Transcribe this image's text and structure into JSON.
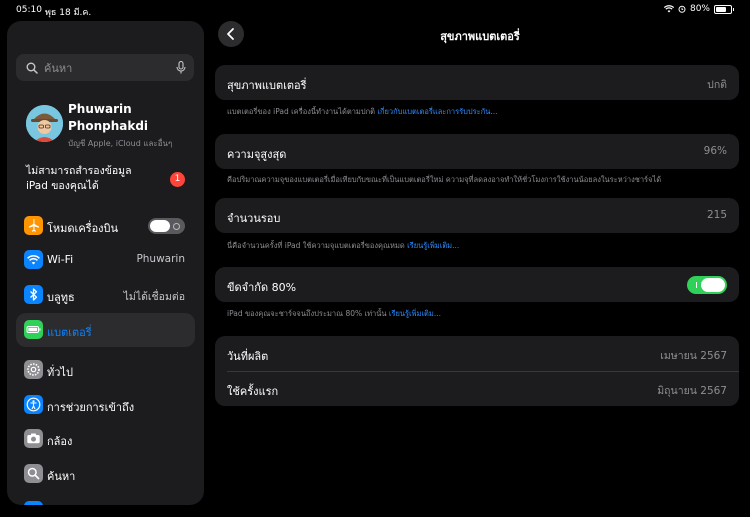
{
  "status": {
    "time": "05:10",
    "date": "พุธ 18 มี.ค.",
    "battery": "80%"
  },
  "sidebar": {
    "search_placeholder": "ค้นหา",
    "profile": {
      "name": "Phuwarin Phonphakdi",
      "subtitle": "บัญชี Apple, iCloud และอื่นๆ"
    },
    "notice": {
      "text": "ไม่สามารถสำรองข้อมูล iPad ของคุณได้",
      "badge": "1"
    },
    "items": [
      {
        "label": "โหมดเครื่องบิน",
        "value": "",
        "icon": "airplane-icon",
        "color": "#ff9500"
      },
      {
        "label": "Wi-Fi",
        "value": "Phuwarin",
        "icon": "wifi-icon",
        "color": "#0a84ff"
      },
      {
        "label": "บลูทูธ",
        "value": "ไม่ได้เชื่อมต่อ",
        "icon": "bluetooth-icon",
        "color": "#0a84ff"
      },
      {
        "label": "แบตเตอรี่",
        "value": "",
        "icon": "battery-icon",
        "color": "#30d158"
      },
      {
        "label": "ทั่วไป",
        "value": "",
        "icon": "gear-icon",
        "color": "#8e8e93"
      },
      {
        "label": "การช่วยการเข้าถึง",
        "value": "",
        "icon": "accessibility-icon",
        "color": "#0a84ff"
      },
      {
        "label": "กล้อง",
        "value": "",
        "icon": "camera-icon",
        "color": "#8e8e93"
      },
      {
        "label": "ค้นหา",
        "value": "",
        "icon": "search-icon",
        "color": "#8e8e93"
      }
    ]
  },
  "main": {
    "title": "สุขภาพแบตเตอรี่",
    "health": {
      "label": "สุขภาพแบตเตอรี่",
      "value": "ปกติ",
      "footer": "แบตเตอรี่ของ iPad เครื่องนี้ทำงานได้ตามปกติ",
      "link": "เกี่ยวกับแบตเตอรี่และการรับประกัน..."
    },
    "max_capacity": {
      "label": "ความจุสูงสุด",
      "value": "96%",
      "footer": "คือปริมาณความจุของแบตเตอรี่เมื่อเทียบกับขณะที่เป็นแบตเตอรี่ใหม่ ความจุที่ลดลงอาจทำให้ชั่วโมงการใช้งานน้อยลงในระหว่างชาร์จได้"
    },
    "cycle_count": {
      "label": "จำนวนรอบ",
      "value": "215",
      "footer": "นี่คือจำนวนครั้งที่ iPad ใช้ความจุแบตเตอรี่ของคุณหมด",
      "link": "เรียนรู้เพิ่มเติม..."
    },
    "limit": {
      "label": "ขีดจำกัด 80%",
      "enabled": true,
      "footer": "iPad ของคุณจะชาร์จจนถึงประมาณ 80% เท่านั้น",
      "link": "เรียนรู้เพิ่มเติม..."
    },
    "dates": {
      "manufacture_label": "วันที่ผลิต",
      "manufacture_value": "เมษายน 2567",
      "first_use_label": "ใช้ครั้งแรก",
      "first_use_value": "มิถุนายน 2567"
    }
  }
}
